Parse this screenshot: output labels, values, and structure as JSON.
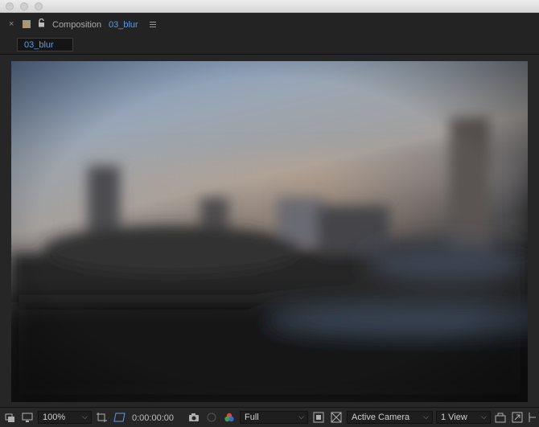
{
  "window": {
    "traffic_lights": [
      "close",
      "minimize",
      "zoom"
    ]
  },
  "panel": {
    "close_glyph": "×",
    "label": "Composition",
    "comp_name": "03_blur",
    "swatch_color": "#a8967a",
    "accent_color": "#5a9be4"
  },
  "tabs": [
    {
      "label": "03_blur",
      "active": true
    }
  ],
  "toolbar": {
    "magnification": "100%",
    "timecode": "0:00:00:00",
    "resolution": "Full",
    "camera": "Active Camera",
    "views": "1 View",
    "icons": [
      "always-preview-icon",
      "monitor-icon",
      "grid-guide-icon",
      "mask-visibility-icon",
      "snapshot-icon",
      "show-snapshot-icon",
      "color-channels-icon",
      "region-of-interest-icon",
      "transparency-grid-icon",
      "reset-exposure-icon",
      "flowchart-icon",
      "fast-previews-icon"
    ]
  }
}
